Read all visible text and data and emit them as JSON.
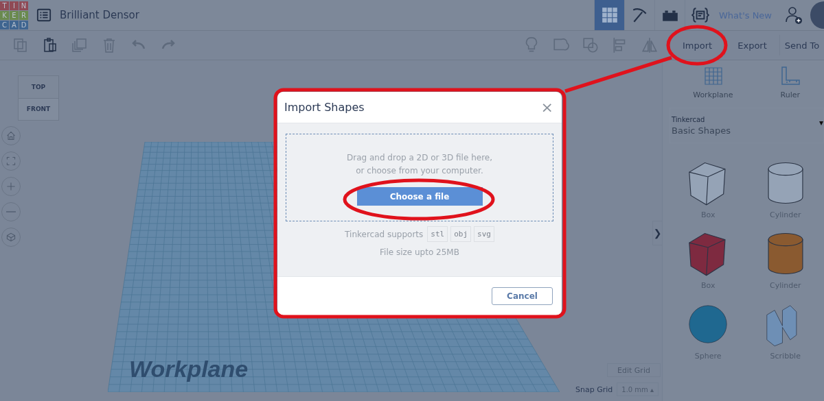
{
  "header": {
    "logo_rows": [
      {
        "letters": [
          "T",
          "I",
          "N"
        ],
        "color": "#8f4a55"
      },
      {
        "letters": [
          "K",
          "E",
          "R"
        ],
        "color": "#6a8a4e"
      },
      {
        "letters": [
          "C",
          "A",
          "D"
        ],
        "color": "#3f6590"
      }
    ],
    "title": "Brilliant Densor",
    "view_tabs": [
      {
        "kind": "grid",
        "selected": true
      },
      {
        "kind": "pickaxe",
        "selected": false
      },
      {
        "kind": "brick",
        "selected": false
      },
      {
        "kind": "code",
        "selected": false
      }
    ],
    "whats_new": "What's New"
  },
  "toolbar": {
    "edit_tools": [
      {
        "kind": "copy",
        "disabled": true
      },
      {
        "kind": "paste",
        "disabled": false
      },
      {
        "kind": "duplicate",
        "disabled": true
      },
      {
        "kind": "delete",
        "disabled": true
      },
      {
        "kind": "undo",
        "disabled": true
      },
      {
        "kind": "redo",
        "disabled": true
      }
    ],
    "shape_tools": [
      {
        "kind": "note",
        "disabled": true
      },
      {
        "kind": "group",
        "disabled": true
      },
      {
        "kind": "hole",
        "disabled": true
      },
      {
        "kind": "align",
        "disabled": true
      },
      {
        "kind": "mirror",
        "disabled": true
      }
    ],
    "actions": [
      "Import",
      "Export",
      "Send To"
    ]
  },
  "viewport": {
    "view_cube": {
      "top": "TOP",
      "front": "FRONT"
    },
    "nav_buttons": [
      {
        "kind": "home"
      },
      {
        "kind": "fit"
      },
      {
        "kind": "zoom-in"
      },
      {
        "kind": "zoom-out"
      },
      {
        "kind": "perspective"
      }
    ],
    "workplane_label": "Workplane",
    "edit_grid": "Edit Grid",
    "snap_grid": {
      "label": "Snap Grid",
      "value": "1.0 mm",
      "caret": "▴"
    },
    "collapse": "❯"
  },
  "panel": {
    "tools": [
      {
        "kind": "workplane",
        "label": "Workplane"
      },
      {
        "kind": "ruler",
        "label": "Ruler"
      }
    ],
    "library": {
      "label": "Tinkercad",
      "value": "Basic Shapes",
      "caret": "▾"
    },
    "shapes": [
      {
        "kind": "box",
        "label": "Box",
        "color": "#95a3b6"
      },
      {
        "kind": "cylinder",
        "label": "Cylinder",
        "color": "#95a3b6"
      },
      {
        "kind": "box",
        "label": "Box",
        "color": "#7e2a40"
      },
      {
        "kind": "cylinder",
        "label": "Cylinder",
        "color": "#8a5a30"
      },
      {
        "kind": "sphere",
        "label": "Sphere",
        "color": "#1f6890"
      },
      {
        "kind": "scribble",
        "label": "Scribble",
        "color": "#6e8fb5"
      }
    ]
  },
  "modal": {
    "title": "Import Shapes",
    "close": "×",
    "drop_lines": [
      "Drag and drop a 2D or 3D file here,",
      "or choose from your computer."
    ],
    "choose_button": "Choose a file",
    "supports_label": "Tinkercad supports",
    "formats": [
      "stl",
      "obj",
      "svg"
    ],
    "size_note": "File size upto 25MB",
    "cancel": "Cancel"
  }
}
